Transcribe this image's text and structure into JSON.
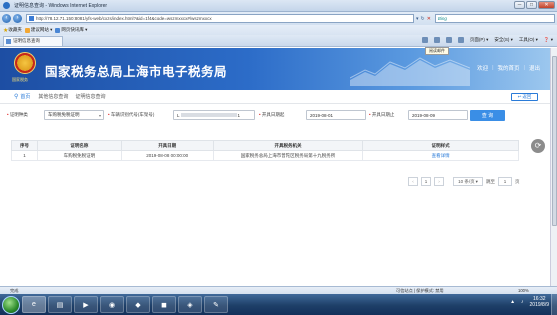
{
  "window": {
    "title": "证明信息查询 - Windows Internet Explorer",
    "controls": {
      "minimize": "─",
      "maximize": "□",
      "close": "✕"
    }
  },
  "browser": {
    "address": "http://78.12.71.150:8081/yfs-web/cxzs/index.html?&id=1f4&code=wszmxxcx#/wszmxxcx",
    "search_placeholder": "Bing",
    "favorites_label": "收藏夹",
    "favorites": [
      "建议网站 ▾",
      "网页快讯库 ▾"
    ],
    "tab_title": "证明信息查询",
    "commands": [
      "页面(P) ▾",
      "安全(S) ▾",
      "工具(O) ▾",
      "❓ ▾"
    ],
    "tooltip": "阅读邮件"
  },
  "site": {
    "emblem_text": "国家税务",
    "title": "国家税务总局上海市电子税务局",
    "welcome": "欢迎",
    "user_sep": "|",
    "home_link": "我的首页",
    "logout": "退出"
  },
  "breadcrumb": {
    "home": "首页",
    "items": [
      "其他信息查询",
      "证明信息查询"
    ]
  },
  "back_button": "返回",
  "filters": {
    "cert_type_label": "证明种类",
    "cert_type_value": "车购税免税证明",
    "vin_label": "车辆识别代号(车架号)",
    "vin_value": "L",
    "vin_suffix": "1",
    "start_label": "开具日期起",
    "start_value": "2019-08-01",
    "end_label": "开具日期止",
    "end_value": "2019-08-09",
    "query_button": "查 询"
  },
  "table": {
    "headers": [
      "序号",
      "证明名称",
      "开具日期",
      "开具税务机关",
      "证明样式"
    ],
    "rows": [
      [
        "1",
        "车购税免税证明",
        "2019-08-08 00:00:00",
        "国家税务总局上海市普陀区税务局第十九税务所",
        "查看详情"
      ]
    ]
  },
  "pager": {
    "prev": "‹",
    "page": "1",
    "next": "›",
    "page_size": "10 条/页",
    "goto_label": "跳至",
    "goto_value": "1",
    "goto_suffix": "页"
  },
  "statusbar": {
    "done": "完成",
    "zone": "可信站点 | 保护模式: 禁用",
    "zoom": "100%"
  },
  "taskbar": {
    "time": "16:32",
    "date": "2019/8/9"
  }
}
